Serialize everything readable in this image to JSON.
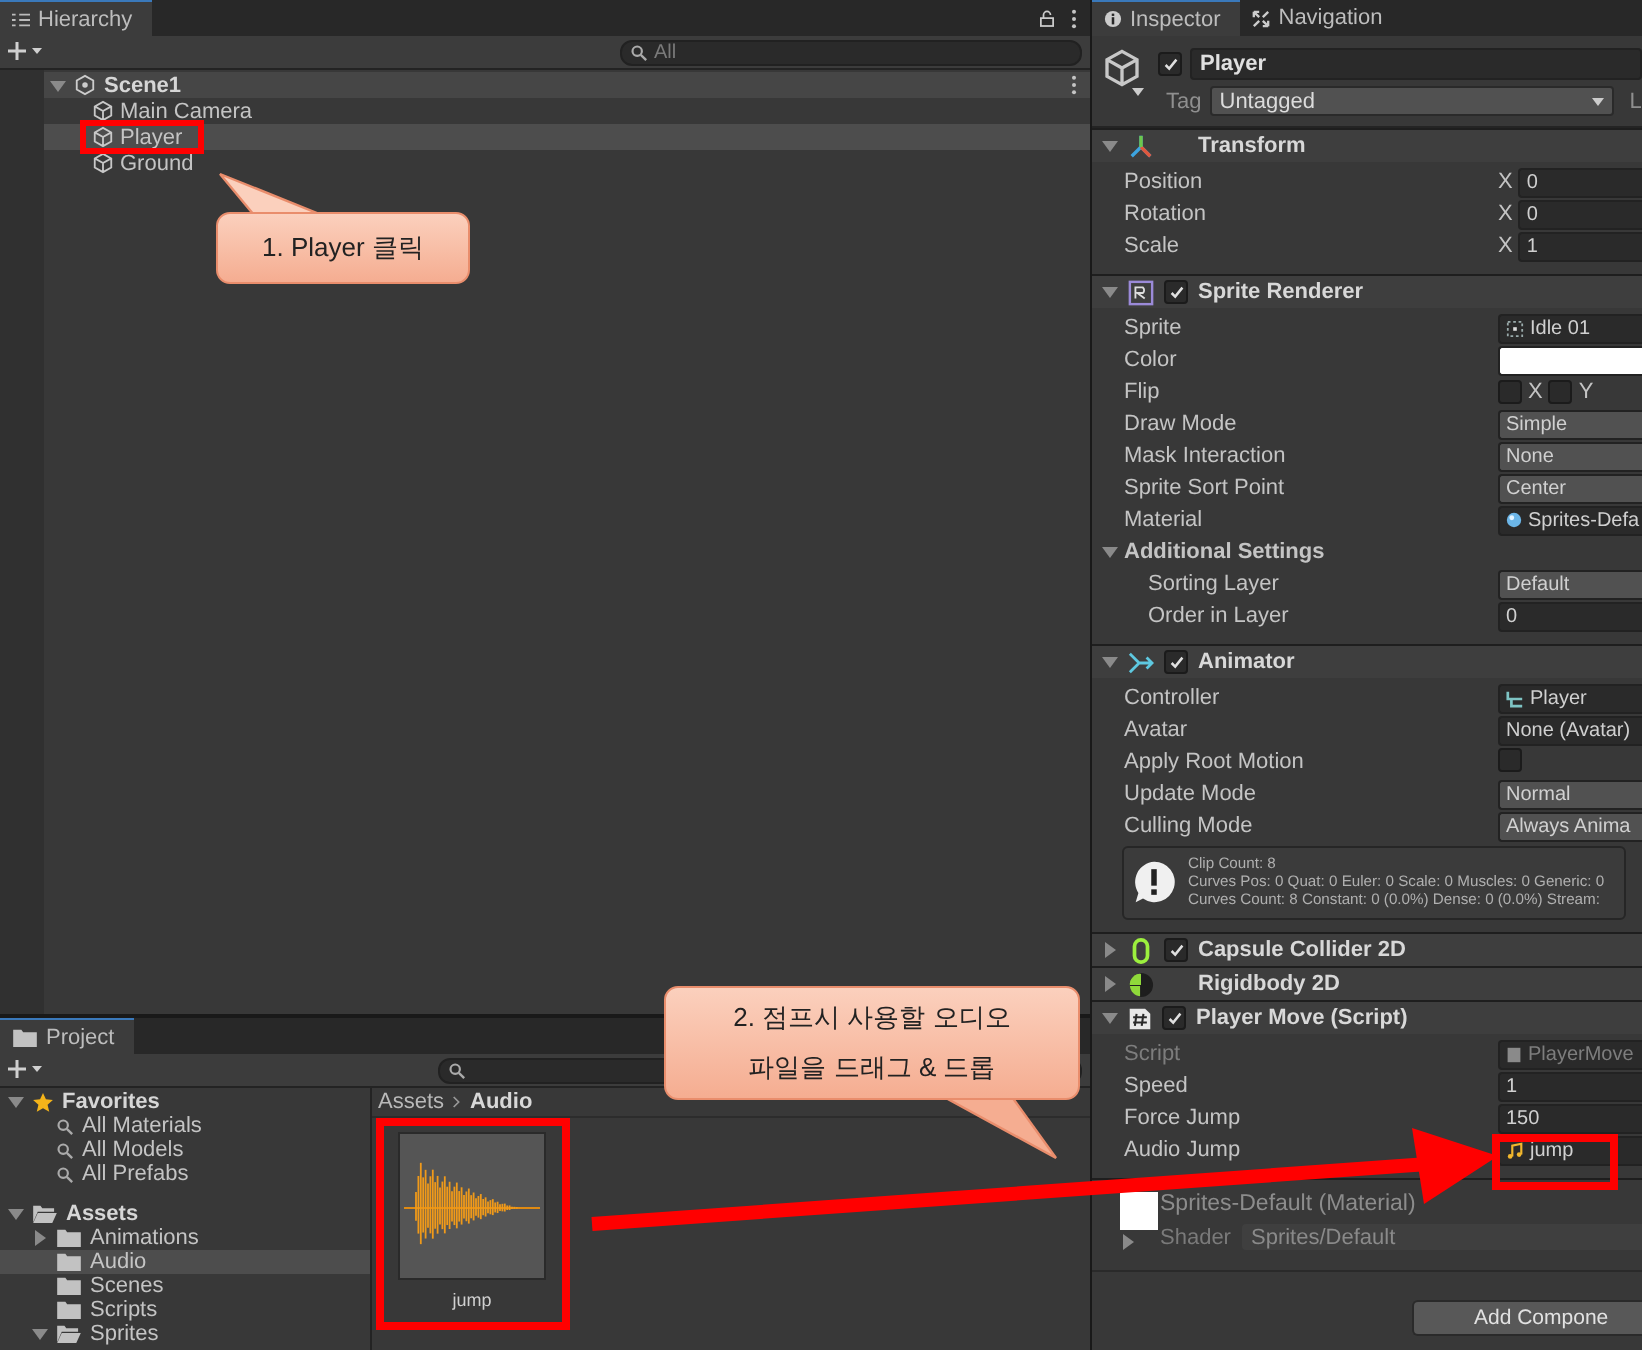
{
  "hierarchy": {
    "tab": "Hierarchy",
    "search_placeholder": "All",
    "scene": {
      "name": "Scene1",
      "expanded": true
    },
    "items": [
      {
        "label": "Main Camera",
        "selected": false
      },
      {
        "label": "Player",
        "selected": true
      },
      {
        "label": "Ground",
        "selected": false
      }
    ]
  },
  "project": {
    "tab": "Project",
    "tree": [
      {
        "label": "Favorites",
        "kind": "favorites",
        "expanded": true,
        "selected": false,
        "children": [
          {
            "label": "All Materials",
            "kind": "search",
            "selected": false
          },
          {
            "label": "All Models",
            "kind": "search",
            "selected": false
          },
          {
            "label": "All Prefabs",
            "kind": "search",
            "selected": false
          }
        ]
      },
      {
        "label": "Assets",
        "kind": "folder_open",
        "expanded": true,
        "selected": false,
        "children": [
          {
            "label": "Animations",
            "kind": "folder",
            "expanded": false,
            "selected": false
          },
          {
            "label": "Audio",
            "kind": "folder",
            "selected": true
          },
          {
            "label": "Scenes",
            "kind": "folder",
            "selected": false
          },
          {
            "label": "Scripts",
            "kind": "folder",
            "selected": false
          },
          {
            "label": "Sprites",
            "kind": "folder_open",
            "expanded": true,
            "selected": false
          }
        ]
      }
    ],
    "breadcrumb": [
      "Assets",
      "Audio"
    ],
    "files": [
      {
        "name": "jump",
        "kind": "audio"
      }
    ]
  },
  "inspector": {
    "tabs": [
      {
        "label": "Inspector",
        "kind": "info",
        "selected": true
      },
      {
        "label": "Navigation",
        "kind": "navigation",
        "selected": false
      }
    ],
    "object": {
      "active": true,
      "name": "Player",
      "tag_label": "Tag",
      "tag": "Untagged",
      "layer_label": "L"
    },
    "components": [
      {
        "title": "Transform",
        "kind": "transform",
        "expanded": true,
        "fields": [
          {
            "kind": "vector",
            "label": "Position",
            "axis": "X",
            "value": "0"
          },
          {
            "kind": "vector",
            "label": "Rotation",
            "axis": "X",
            "value": "0"
          },
          {
            "kind": "vector",
            "label": "Scale",
            "axis": "X",
            "value": "1"
          }
        ]
      },
      {
        "title": "Sprite Renderer",
        "kind": "sprite_renderer",
        "enabled": true,
        "expanded": true,
        "fields": [
          {
            "kind": "sprite_ref",
            "label": "Sprite",
            "value": "Idle 01"
          },
          {
            "kind": "color",
            "label": "Color",
            "color": "#ffffff"
          },
          {
            "kind": "flip",
            "label": "Flip",
            "axes": [
              {
                "label": "X",
                "checked": false
              },
              {
                "label": "Y",
                "checked": false
              }
            ]
          },
          {
            "kind": "dropdown",
            "label": "Draw Mode",
            "value": "Simple"
          },
          {
            "kind": "dropdown",
            "label": "Mask Interaction",
            "value": "None"
          },
          {
            "kind": "dropdown",
            "label": "Sprite Sort Point",
            "value": "Center"
          },
          {
            "kind": "material_ref",
            "label": "Material",
            "value": "Sprites-Defa"
          },
          {
            "kind": "foldout",
            "label": "Additional Settings",
            "expanded": true,
            "children": [
              {
                "kind": "dropdown",
                "label": "Sorting Layer",
                "value": "Default"
              },
              {
                "kind": "number",
                "label": "Order in Layer",
                "value": "0"
              }
            ]
          }
        ]
      },
      {
        "title": "Animator",
        "kind": "animator",
        "enabled": true,
        "expanded": true,
        "fields": [
          {
            "kind": "controller_ref",
            "label": "Controller",
            "value": "Player"
          },
          {
            "kind": "object_ref",
            "label": "Avatar",
            "value": "None (Avatar)"
          },
          {
            "kind": "toggle",
            "label": "Apply Root Motion",
            "checked": false
          },
          {
            "kind": "dropdown",
            "label": "Update Mode",
            "value": "Normal"
          },
          {
            "kind": "dropdown",
            "label": "Culling Mode",
            "value": "Always Anima"
          },
          {
            "kind": "info",
            "lines": [
              "Clip Count: 8",
              "Curves Pos: 0 Quat: 0 Euler: 0 Scale: 0 Muscles: 0 Generic: 0",
              "Curves Count: 8 Constant: 0 (0.0%) Dense: 0 (0.0%) Stream:"
            ]
          }
        ]
      },
      {
        "title": "Capsule Collider 2D",
        "kind": "collider",
        "enabled": true,
        "expanded": false
      },
      {
        "title": "Rigidbody 2D",
        "kind": "rigidbody",
        "expanded": false
      },
      {
        "title": "Player Move (Script)",
        "kind": "script",
        "enabled": true,
        "expanded": true,
        "fields": [
          {
            "kind": "script_ref",
            "label": "Script",
            "value": "PlayerMove",
            "disabled": true
          },
          {
            "kind": "number",
            "label": "Speed",
            "value": "1",
            "disabled": false
          },
          {
            "kind": "number",
            "label": "Force Jump",
            "value": "150",
            "disabled": false
          },
          {
            "kind": "audio_ref",
            "label": "Audio Jump",
            "value": "jump",
            "disabled": false
          }
        ]
      }
    ],
    "material": {
      "name": "Sprites-Default (Material)",
      "shader_label": "Shader",
      "shader": "Sprites/Default",
      "expanded": false
    },
    "add_button": "Add Compone"
  },
  "annotations": [
    {
      "kind": "callout",
      "text": "1. Player 클릭"
    },
    {
      "kind": "callout",
      "text": "2. 점프시 사용할 오디오 파일을 드래그 & 드롭"
    }
  ]
}
